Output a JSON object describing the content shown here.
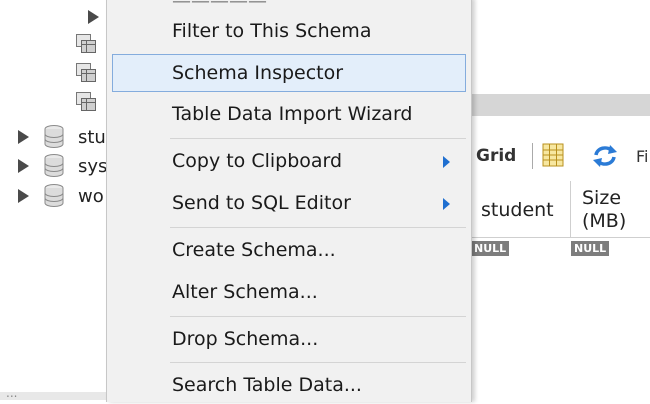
{
  "navigator": {
    "schemas": [
      {
        "label": "stu"
      },
      {
        "label": "sys"
      },
      {
        "label": "wo"
      }
    ],
    "bottom_label": "..."
  },
  "context_menu": {
    "items": [
      {
        "label": "Filter to This Schema"
      },
      {
        "label": "Schema Inspector",
        "hovered": true
      },
      {
        "label": "Table Data Import Wizard"
      },
      {
        "label": "Copy to Clipboard",
        "submenu": true
      },
      {
        "label": "Send to SQL Editor",
        "submenu": true
      },
      {
        "label": "Create Schema..."
      },
      {
        "label": "Alter Schema..."
      },
      {
        "label": "Drop Schema..."
      },
      {
        "label": "Search Table Data..."
      }
    ]
  },
  "result_panel": {
    "toolbar": {
      "grid_label": "Grid",
      "filter_partial": "Fi"
    },
    "columns": [
      {
        "label": "student"
      },
      {
        "label": "Size (MB)"
      }
    ],
    "row": [
      "NULL",
      "NULL"
    ]
  },
  "colors": {
    "menu_background": "#f1f1f1",
    "menu_hover": "#e3eefa",
    "menu_hover_border": "#84acdd",
    "submenu_arrow": "#1f6fd0",
    "null_badge": "#7d7d7d"
  },
  "icons": [
    "expand-arrow-icon",
    "table-icon",
    "database-icon",
    "grid-layout-icon",
    "refresh-icon",
    "submenu-arrow-icon"
  ]
}
